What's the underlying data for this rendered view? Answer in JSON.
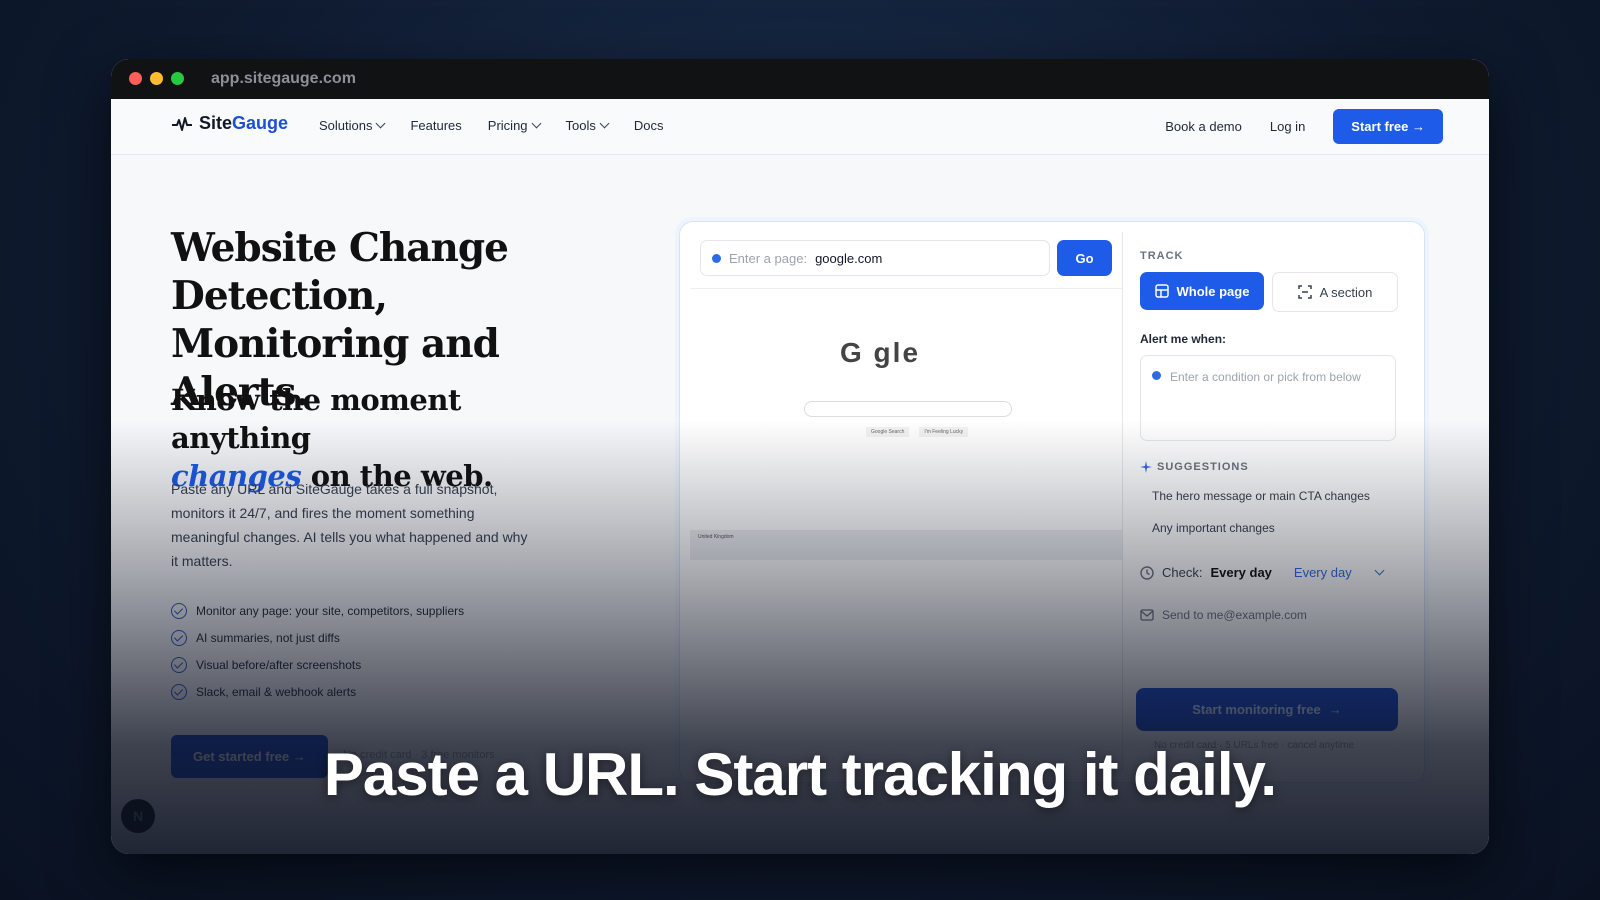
{
  "window": {
    "url": "app.sitegauge.com"
  },
  "nav": {
    "logo_text_1": "Site",
    "logo_text_2": "Gauge",
    "links": [
      "Solutions",
      "Features",
      "Pricing",
      "Tools",
      "Docs"
    ],
    "book_demo": "Book a demo",
    "login": "Log in",
    "start_free": "Start free →"
  },
  "hero": {
    "title": "Website Change Detection, Monitoring and Alerts.",
    "sub_1": "Know the moment anything",
    "sub_changes": "changes",
    "sub_2": " on the web.",
    "description": "Paste any URL and SiteGauge takes a full snapshot, monitors it 24/7, and fires the moment something meaningful changes. AI tells you what happened and why it matters.",
    "features": [
      "Monitor any page: your site, competitors, suppliers",
      "AI summaries, not just diffs",
      "Visual before/after screenshots",
      "Slack, email & webhook alerts"
    ],
    "cta": "Get started free →",
    "cta_note": "No credit card · 3 free monitors"
  },
  "panel": {
    "url_placeholder": "Enter a page:",
    "url_value": "google.com",
    "go": "Go",
    "preview_logo": "G  gle",
    "preview_btn_1": "Google Search",
    "preview_btn_2": "I'm Feeling Lucky",
    "preview_footer": "United Kingdom",
    "track_label": "TRACK",
    "whole_page": "Whole page",
    "a_section": "A section",
    "alert_label": "Alert me when:",
    "condition_placeholder": "Enter a condition or pick from below",
    "suggestions_label": "SUGGESTIONS",
    "suggestions": [
      "The hero message or main CTA changes",
      "Any important changes"
    ],
    "check_label": "Check:",
    "check_value": "Every day",
    "check_select": "Every day",
    "email_placeholder": "Send to me@example.com",
    "monitor_btn": "Start monitoring free",
    "fineprint": "No credit card · 5 URLs free · cancel anytime"
  },
  "caption": "Paste a URL. Start tracking it daily.",
  "avatar_letter": "N",
  "colors": {
    "accent": "#1d5be8",
    "bg": "#0f1b30"
  }
}
